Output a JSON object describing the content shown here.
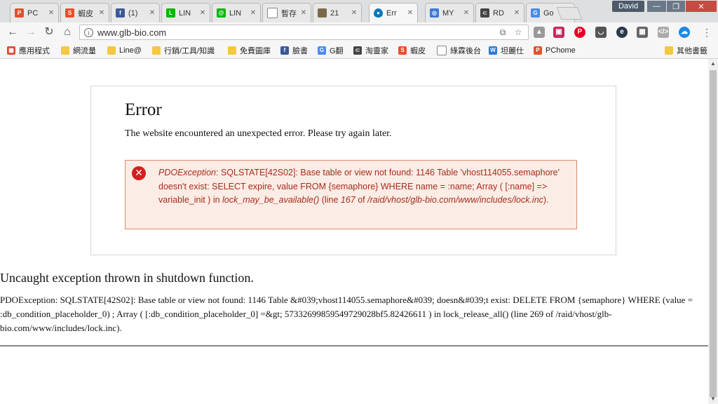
{
  "tabs": [
    {
      "label": "PC",
      "icon": "pchome-icon",
      "color": "#e0522e"
    },
    {
      "label": "蝦皮",
      "icon": "shopee-icon",
      "color": "#ee4d2d"
    },
    {
      "label": "(1)",
      "icon": "facebook-icon",
      "color": "#3b5998"
    },
    {
      "label": "LIN",
      "icon": "line-icon",
      "color": "#00b900"
    },
    {
      "label": "LIN",
      "icon": "line-at-icon",
      "color": "#00b900"
    },
    {
      "label": "暫存",
      "icon": "document-icon",
      "color": "#888888"
    },
    {
      "label": "21",
      "icon": "image-icon",
      "color": "#7a6a4a"
    },
    {
      "label": "Err",
      "icon": "drupal-icon",
      "color": "#0678be",
      "active": true
    },
    {
      "label": "MY",
      "icon": "globe-icon",
      "color": "#3a7bd5"
    },
    {
      "label": "RD",
      "icon": "link-icon",
      "color": "#444444"
    },
    {
      "label": "Go",
      "icon": "google-translate-icon",
      "color": "#4a8af4"
    }
  ],
  "window": {
    "profile_name": "David",
    "minimize": "—",
    "maximize": "❐",
    "close": "✕"
  },
  "toolbar": {
    "back": "←",
    "forward": "→",
    "reload": "↻",
    "home": "⌂",
    "url": "www.glb-bio.com",
    "menu": "⋮"
  },
  "bookmarks": [
    {
      "label": "應用程式",
      "icon": "apps-icon",
      "color": "#e04a3a"
    },
    {
      "label": "網流量",
      "icon": "folder-icon",
      "color": "#f5c842"
    },
    {
      "label": "Line@",
      "icon": "folder-icon",
      "color": "#f5c842"
    },
    {
      "label": "行銷/工具/知識",
      "icon": "folder-icon",
      "color": "#f5c842"
    },
    {
      "label": "免費圖庫",
      "icon": "folder-icon",
      "color": "#f5c842"
    },
    {
      "label": "臉書",
      "icon": "facebook-icon",
      "color": "#3b5998"
    },
    {
      "label": "G翻",
      "icon": "google-translate-icon",
      "color": "#4a8af4"
    },
    {
      "label": "淘靈家",
      "icon": "link-icon",
      "color": "#444444"
    },
    {
      "label": "蝦皮",
      "icon": "shopee-icon",
      "color": "#ee4d2d"
    },
    {
      "label": "綠霖後台",
      "icon": "document-icon",
      "color": "#888888"
    },
    {
      "label": "坦麗仕",
      "icon": "w-icon",
      "color": "#2a7ad8"
    },
    {
      "label": "PChome",
      "icon": "pchome-icon",
      "color": "#e0522e"
    },
    {
      "label": "其他書籤",
      "icon": "folder-icon",
      "color": "#f5c842"
    }
  ],
  "page": {
    "error_title": "Error",
    "error_description": "The website encountered an unexpected error. Please try again later.",
    "exception_name": "PDOException",
    "message_part1": ": SQLSTATE[42S02]: Base table or view not found: 1146 Table 'vhost114055.semaphore' doesn't exist: SELECT expire, value FROM {semaphore} WHERE name = :name; Array ( [:name] => variable_init ) in ",
    "function_name": "lock_may_be_available()",
    "message_part2": " (line ",
    "line_number": "167",
    "message_part3": " of ",
    "file_path": "/raid/vhost/glb-bio.com/www/includes/lock.inc",
    "message_part4": ").",
    "uncaught_title": "Uncaught exception thrown in shutdown function.",
    "uncaught_body": "PDOException: SQLSTATE[42S02]: Base table or view not found: 1146 Table &#039;vhost114055.semaphore&#039; doesn&#039;t exist: DELETE FROM {semaphore} WHERE (value = :db_condition_placeholder_0) ; Array ( [:db_condition_placeholder_0] =&gt; 57332699859549729028bf5.82426611 ) in lock_release_all() (line 269 of /raid/vhost/glb-bio.com/www/includes/lock.inc)."
  }
}
